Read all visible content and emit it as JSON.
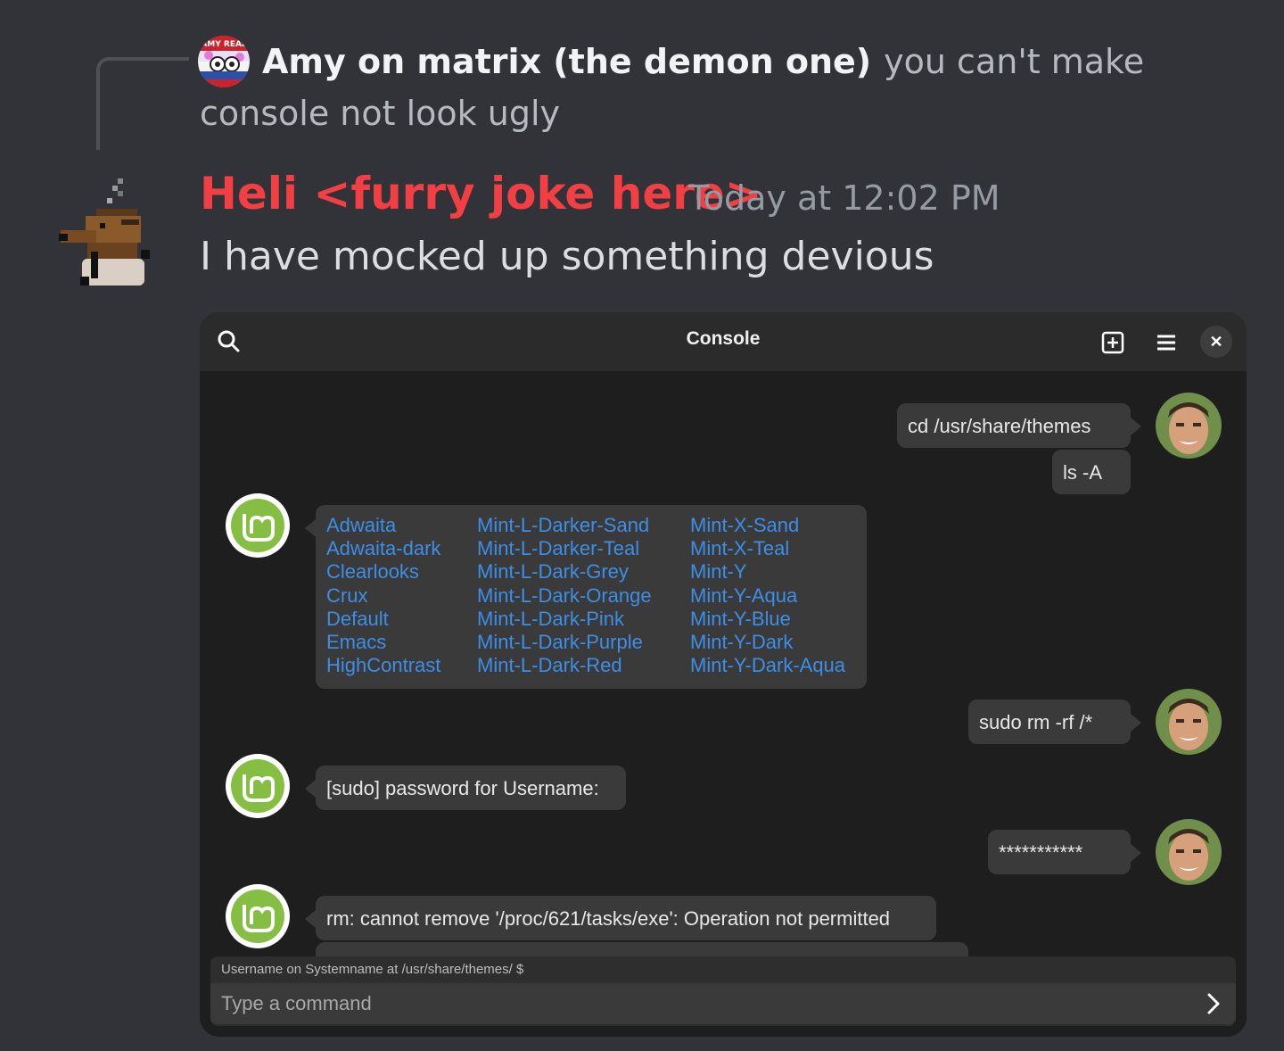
{
  "reply": {
    "author": "Amy on matrix (the demon one)",
    "text": "you can't make console not look ugly",
    "avatar_badge": "AMY REAL"
  },
  "message": {
    "author": "Heli <furry joke here>",
    "timestamp": "Today at 12:02 PM",
    "text": "I have mocked up something devious",
    "author_color": "#f23f43"
  },
  "console": {
    "title": "Console",
    "messages": {
      "cmd1": "cd /usr/share/themes",
      "cmd2": "ls -A",
      "cmd3": "sudo rm -rf /*",
      "password_prompt": "[sudo] password for Username:",
      "password": "***********",
      "error": "rm: cannot remove '/proc/621/tasks/exe': Operation not permitted"
    },
    "listing": {
      "col1": [
        "Adwaita",
        "Adwaita-dark",
        "Clearlooks",
        "Crux",
        "Default",
        "Emacs",
        "HighContrast"
      ],
      "col2": [
        "Mint-L-Darker-Sand",
        "Mint-L-Darker-Teal",
        "Mint-L-Dark-Grey",
        "Mint-L-Dark-Orange",
        "Mint-L-Dark-Pink",
        "Mint-L-Dark-Purple",
        "Mint-L-Dark-Red"
      ],
      "col3": [
        "Mint-X-Sand",
        "Mint-X-Teal",
        "Mint-Y",
        "Mint-Y-Aqua",
        "Mint-Y-Blue",
        "Mint-Y-Dark",
        "Mint-Y-Dark-Aqua"
      ],
      "link_color": "#3d8ee6"
    },
    "prompt_label": "Username on Systemname at /usr/share/themes/ $",
    "input_placeholder": "Type a command",
    "icons": [
      "search-icon",
      "new-tab-icon",
      "hamburger-menu-icon",
      "close-icon",
      "send-chevron-icon",
      "linux-mint-logo-icon"
    ]
  }
}
